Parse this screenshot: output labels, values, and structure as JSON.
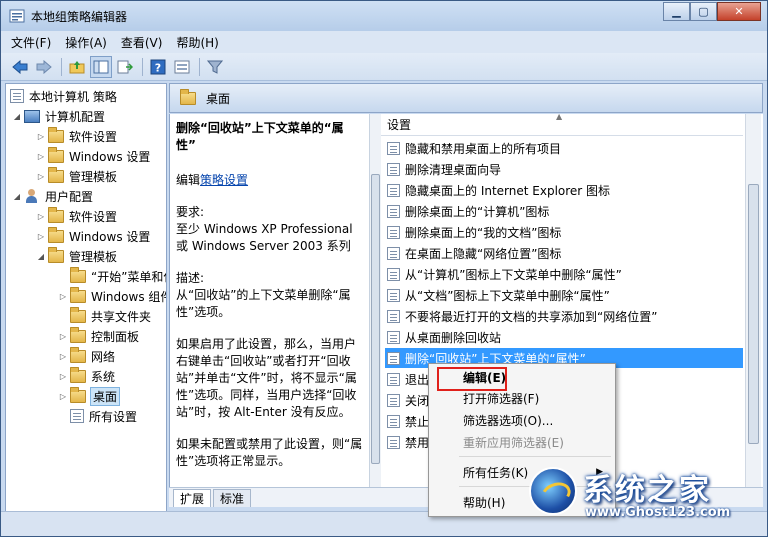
{
  "window": {
    "title": "本地组策略编辑器"
  },
  "menubar": {
    "items": [
      "文件(F)",
      "操作(A)",
      "查看(V)",
      "帮助(H)"
    ]
  },
  "tree": {
    "root": "本地计算机 策略",
    "computer_config": "计算机配置",
    "computer_children": [
      "软件设置",
      "Windows 设置",
      "管理模板"
    ],
    "user_config": "用户配置",
    "user_children": [
      "软件设置",
      "Windows 设置",
      "管理模板"
    ],
    "admin_children": [
      "“开始”菜单和任务栏",
      "Windows 组件",
      "共享文件夹",
      "控制面板",
      "网络",
      "系统",
      "桌面",
      "所有设置"
    ]
  },
  "right_header": {
    "title": "桌面"
  },
  "description": {
    "title": "删除“回收站”上下文菜单的“属性”",
    "edit_prefix": "编辑",
    "edit_link": "策略设置",
    "requirements_label": "要求:",
    "requirements_text": "至少 Windows XP Professional 或 Windows Server 2003 系列",
    "desc_label": "描述:",
    "desc_text": "从“回收站”的上下文菜单删除“属性”选项。",
    "enabled_text": "如果启用了此设置，那么，当用户右键单击“回收站”或者打开“回收站”并单击“文件”时，将不显示“属性”选项。同样，当用户选择“回收站”时，按 Alt-Enter 没有反应。",
    "disabled_text": "如果未配置或禁用了此设置，则“属性”选项将正常显示。"
  },
  "list": {
    "header": "设置",
    "rows": [
      "隐藏和禁用桌面上的所有项目",
      "删除清理桌面向导",
      "隐藏桌面上的 Internet Explorer 图标",
      "删除桌面上的“计算机”图标",
      "删除桌面上的“我的文档”图标",
      "在桌面上隐藏“网络位置”图标",
      "从“计算机”图标上下文菜单中删除“属性”",
      "从“文档”图标上下文菜单中删除“属性”",
      "不要将最近打开的文档的共享添加到“网络位置”",
      "从桌面删除回收站",
      "删除“回收站”上下文菜单的“属性”",
      "退出时不保存设置",
      "关闭 Aero Shake 窗口最小化鼠标手势",
      "禁止用户更改“我的文档”路径",
      "禁用 Active Desktop"
    ]
  },
  "tabs": [
    "扩展",
    "标准"
  ],
  "context_menu": {
    "edit": "编辑(E)",
    "open_filter": "打开筛选器(F)",
    "filter_options": "筛选器选项(O)...",
    "reapply_filter": "重新应用筛选器(E)",
    "all_tasks": "所有任务(K)",
    "help": "帮助(H)"
  },
  "watermark": {
    "title": "系统之家",
    "url": "www.Ghost123.com"
  },
  "colors": {
    "highlight": "#3399ff",
    "annotation": "#e0211b",
    "link": "#0645ad"
  }
}
